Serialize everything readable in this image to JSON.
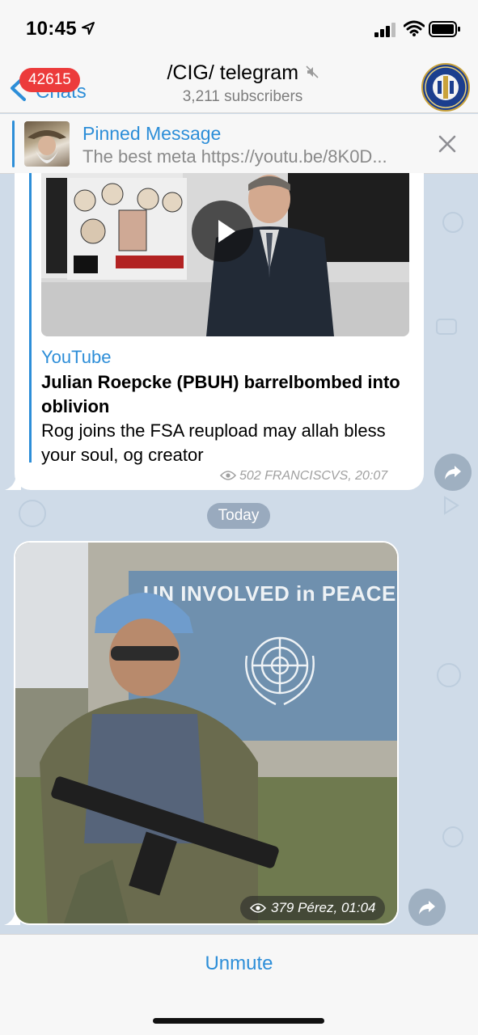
{
  "status_bar": {
    "time": "10:45"
  },
  "nav": {
    "back_label": "Chats",
    "unread_badge": "42615",
    "title": "/CIG/ telegram",
    "subtitle": "3,211 subscribers"
  },
  "pinned": {
    "title": "Pinned Message",
    "text": "The best meta https://youtu.be/8K0D..."
  },
  "messages": [
    {
      "source": "YouTube",
      "title": "Julian Roepcke (PBUH) barrelbombed into oblivion",
      "description": "Rog joins the FSA reupload may allah bless your soul, og creator",
      "meta": "502 FRANCISCVS, 20:07"
    },
    {
      "image_caption_text": "UN INVOLVED in PEACE",
      "meta": "379 Pérez, 01:04"
    }
  ],
  "date_separator": "Today",
  "bottom": {
    "action_label": "Unmute"
  },
  "colors": {
    "accent": "#2d8ed8",
    "badge": "#ec3b3b",
    "chat_background": "#cfdbe8"
  }
}
